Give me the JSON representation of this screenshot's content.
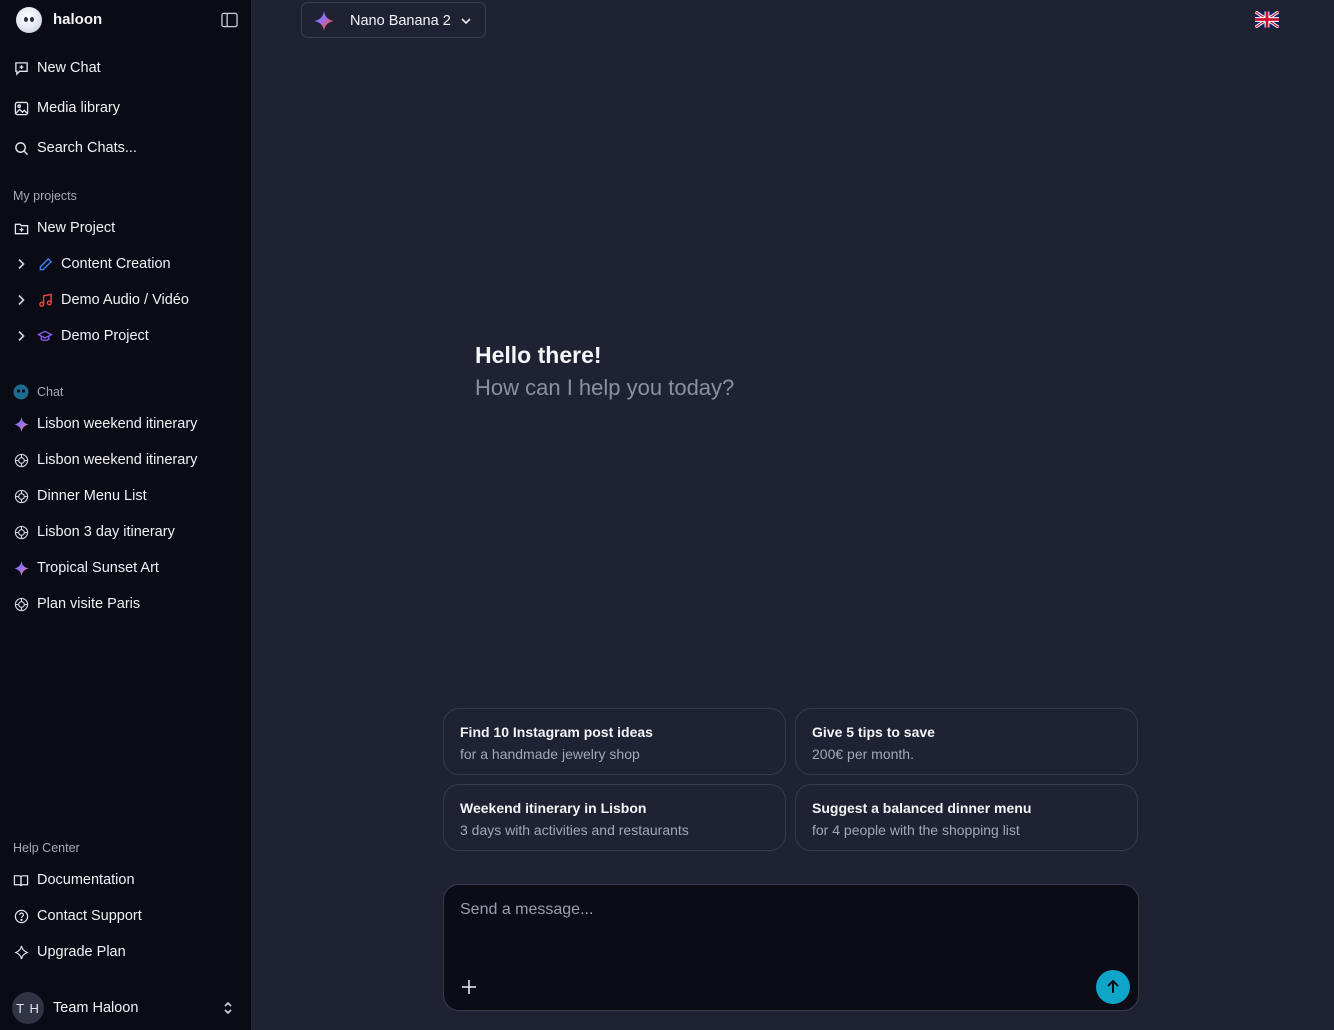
{
  "sidebar": {
    "brand": "haloon",
    "top_items": [
      {
        "label": "New Chat",
        "icon": "new-chat-icon"
      },
      {
        "label": "Media library",
        "icon": "image-icon"
      },
      {
        "label": "Search Chats...",
        "icon": "search-icon"
      }
    ],
    "projects_label": "My projects",
    "new_project_label": "New Project",
    "projects": [
      {
        "label": "Content Creation",
        "icon": "pencil-icon",
        "color": "#3b82f6"
      },
      {
        "label": "Demo Audio / Vidéo",
        "icon": "music-note-icon",
        "color": "#ef4444"
      },
      {
        "label": "Demo Project",
        "icon": "graduation-cap-icon",
        "color": "#8b5cf6"
      }
    ],
    "chat_label": "Chat",
    "chats": [
      {
        "label": "Lisbon weekend itinerary",
        "icon": "gemini-sparkle-icon"
      },
      {
        "label": "Lisbon weekend itinerary",
        "icon": "openai-icon"
      },
      {
        "label": "Dinner Menu List",
        "icon": "openai-icon"
      },
      {
        "label": "Lisbon 3 day itinerary",
        "icon": "openai-icon"
      },
      {
        "label": "Tropical Sunset Art",
        "icon": "gemini-sparkle-icon"
      },
      {
        "label": "Plan visite Paris",
        "icon": "openai-icon"
      }
    ],
    "help_label": "Help Center",
    "help_items": [
      {
        "label": "Documentation",
        "icon": "book-icon"
      },
      {
        "label": "Contact Support",
        "icon": "help-circle-icon"
      },
      {
        "label": "Upgrade Plan",
        "icon": "sparkle-icon"
      }
    ],
    "user": {
      "initials": "T H",
      "name": "Team Haloon"
    }
  },
  "header": {
    "model_name": "Nano Banana 2",
    "language_flag": "uk-flag-icon"
  },
  "main": {
    "greeting_title": "Hello there!",
    "greeting_subtitle": "How can I help you today?",
    "suggestions": [
      {
        "title": "Find 10 Instagram post ideas",
        "subtitle": "for a handmade jewelry shop"
      },
      {
        "title": "Give 5 tips to save",
        "subtitle": "200€ per month."
      },
      {
        "title": "Weekend itinerary in Lisbon",
        "subtitle": "3 days with activities and restaurants"
      },
      {
        "title": "Suggest a balanced dinner menu",
        "subtitle": "for 4 people with the shopping list"
      }
    ],
    "composer": {
      "placeholder": "Send a message...",
      "value": ""
    }
  },
  "colors": {
    "accent_send": "#0ea5c9",
    "sidebar_bg": "#0a0b14",
    "main_bg": "#1f2232"
  }
}
